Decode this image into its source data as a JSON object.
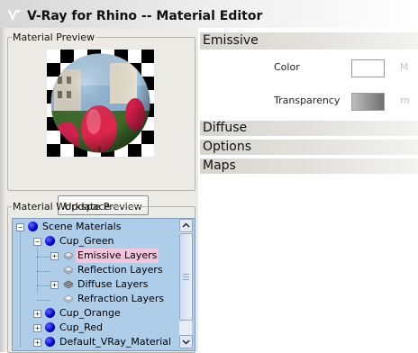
{
  "window": {
    "title": "V-Ray for Rhino -- Material Editor",
    "icon": "v-ray-app-icon"
  },
  "material_preview": {
    "legend": "Material Preview",
    "update_button": "Update Preview"
  },
  "material_workspace": {
    "legend": "Material Workspace",
    "tree": [
      {
        "label": "Scene Materials",
        "expander": "−",
        "icon": "blue-sphere-icon"
      },
      {
        "label": "Cup_Green",
        "expander": "−",
        "icon": "blue-sphere-icon"
      },
      {
        "label": "Emissive Layers",
        "expander": "+",
        "icon": "layer-icon",
        "selected": true
      },
      {
        "label": "Reflection Layers",
        "expander": "",
        "icon": "layer-icon"
      },
      {
        "label": "Diffuse Layers",
        "expander": "+",
        "icon": "layer-icon"
      },
      {
        "label": "Refraction Layers",
        "expander": "",
        "icon": "layer-icon"
      },
      {
        "label": "Cup_Orange",
        "expander": "+",
        "icon": "blue-sphere-icon"
      },
      {
        "label": "Cup_Red",
        "expander": "+",
        "icon": "blue-sphere-icon"
      },
      {
        "label": "Default_VRay_Material",
        "expander": "+",
        "icon": "blue-sphere-icon"
      }
    ]
  },
  "rollouts": {
    "emissive": {
      "title": "Emissive",
      "color_label": "Color",
      "color_value": "#ffffff",
      "color_map_button": "M",
      "transparency_label": "Transparency",
      "transparency_map_button": "m"
    },
    "diffuse": "Diffuse",
    "options": "Options",
    "maps": "Maps"
  },
  "colors": {
    "tree_background": "#aecde8",
    "selected_item": "#f1c6dc",
    "panel_background": "#eceae4"
  }
}
